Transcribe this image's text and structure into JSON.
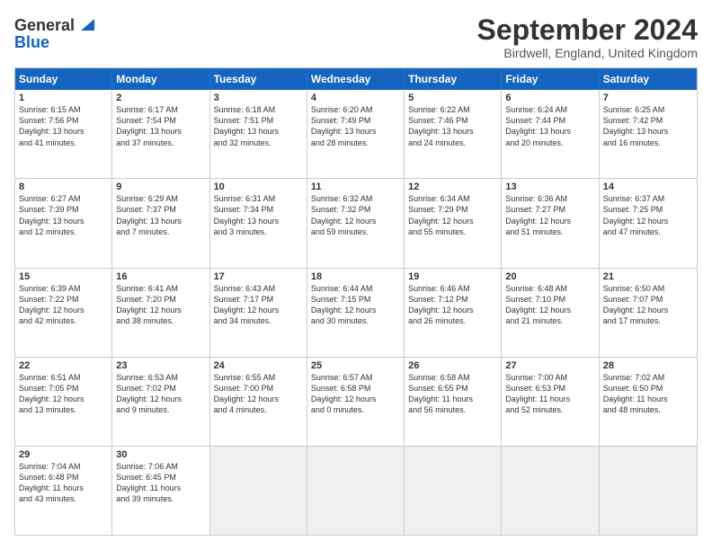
{
  "header": {
    "logo_general": "General",
    "logo_blue": "Blue",
    "month_title": "September 2024",
    "location": "Birdwell, England, United Kingdom"
  },
  "weekdays": [
    "Sunday",
    "Monday",
    "Tuesday",
    "Wednesday",
    "Thursday",
    "Friday",
    "Saturday"
  ],
  "weeks": [
    [
      {
        "day": "1",
        "l1": "Sunrise: 6:15 AM",
        "l2": "Sunset: 7:56 PM",
        "l3": "Daylight: 13 hours",
        "l4": "and 41 minutes."
      },
      {
        "day": "2",
        "l1": "Sunrise: 6:17 AM",
        "l2": "Sunset: 7:54 PM",
        "l3": "Daylight: 13 hours",
        "l4": "and 37 minutes."
      },
      {
        "day": "3",
        "l1": "Sunrise: 6:18 AM",
        "l2": "Sunset: 7:51 PM",
        "l3": "Daylight: 13 hours",
        "l4": "and 32 minutes."
      },
      {
        "day": "4",
        "l1": "Sunrise: 6:20 AM",
        "l2": "Sunset: 7:49 PM",
        "l3": "Daylight: 13 hours",
        "l4": "and 28 minutes."
      },
      {
        "day": "5",
        "l1": "Sunrise: 6:22 AM",
        "l2": "Sunset: 7:46 PM",
        "l3": "Daylight: 13 hours",
        "l4": "and 24 minutes."
      },
      {
        "day": "6",
        "l1": "Sunrise: 6:24 AM",
        "l2": "Sunset: 7:44 PM",
        "l3": "Daylight: 13 hours",
        "l4": "and 20 minutes."
      },
      {
        "day": "7",
        "l1": "Sunrise: 6:25 AM",
        "l2": "Sunset: 7:42 PM",
        "l3": "Daylight: 13 hours",
        "l4": "and 16 minutes."
      }
    ],
    [
      {
        "day": "8",
        "l1": "Sunrise: 6:27 AM",
        "l2": "Sunset: 7:39 PM",
        "l3": "Daylight: 13 hours",
        "l4": "and 12 minutes."
      },
      {
        "day": "9",
        "l1": "Sunrise: 6:29 AM",
        "l2": "Sunset: 7:37 PM",
        "l3": "Daylight: 13 hours",
        "l4": "and 7 minutes."
      },
      {
        "day": "10",
        "l1": "Sunrise: 6:31 AM",
        "l2": "Sunset: 7:34 PM",
        "l3": "Daylight: 13 hours",
        "l4": "and 3 minutes."
      },
      {
        "day": "11",
        "l1": "Sunrise: 6:32 AM",
        "l2": "Sunset: 7:32 PM",
        "l3": "Daylight: 12 hours",
        "l4": "and 59 minutes."
      },
      {
        "day": "12",
        "l1": "Sunrise: 6:34 AM",
        "l2": "Sunset: 7:29 PM",
        "l3": "Daylight: 12 hours",
        "l4": "and 55 minutes."
      },
      {
        "day": "13",
        "l1": "Sunrise: 6:36 AM",
        "l2": "Sunset: 7:27 PM",
        "l3": "Daylight: 12 hours",
        "l4": "and 51 minutes."
      },
      {
        "day": "14",
        "l1": "Sunrise: 6:37 AM",
        "l2": "Sunset: 7:25 PM",
        "l3": "Daylight: 12 hours",
        "l4": "and 47 minutes."
      }
    ],
    [
      {
        "day": "15",
        "l1": "Sunrise: 6:39 AM",
        "l2": "Sunset: 7:22 PM",
        "l3": "Daylight: 12 hours",
        "l4": "and 42 minutes."
      },
      {
        "day": "16",
        "l1": "Sunrise: 6:41 AM",
        "l2": "Sunset: 7:20 PM",
        "l3": "Daylight: 12 hours",
        "l4": "and 38 minutes."
      },
      {
        "day": "17",
        "l1": "Sunrise: 6:43 AM",
        "l2": "Sunset: 7:17 PM",
        "l3": "Daylight: 12 hours",
        "l4": "and 34 minutes."
      },
      {
        "day": "18",
        "l1": "Sunrise: 6:44 AM",
        "l2": "Sunset: 7:15 PM",
        "l3": "Daylight: 12 hours",
        "l4": "and 30 minutes."
      },
      {
        "day": "19",
        "l1": "Sunrise: 6:46 AM",
        "l2": "Sunset: 7:12 PM",
        "l3": "Daylight: 12 hours",
        "l4": "and 26 minutes."
      },
      {
        "day": "20",
        "l1": "Sunrise: 6:48 AM",
        "l2": "Sunset: 7:10 PM",
        "l3": "Daylight: 12 hours",
        "l4": "and 21 minutes."
      },
      {
        "day": "21",
        "l1": "Sunrise: 6:50 AM",
        "l2": "Sunset: 7:07 PM",
        "l3": "Daylight: 12 hours",
        "l4": "and 17 minutes."
      }
    ],
    [
      {
        "day": "22",
        "l1": "Sunrise: 6:51 AM",
        "l2": "Sunset: 7:05 PM",
        "l3": "Daylight: 12 hours",
        "l4": "and 13 minutes."
      },
      {
        "day": "23",
        "l1": "Sunrise: 6:53 AM",
        "l2": "Sunset: 7:02 PM",
        "l3": "Daylight: 12 hours",
        "l4": "and 9 minutes."
      },
      {
        "day": "24",
        "l1": "Sunrise: 6:55 AM",
        "l2": "Sunset: 7:00 PM",
        "l3": "Daylight: 12 hours",
        "l4": "and 4 minutes."
      },
      {
        "day": "25",
        "l1": "Sunrise: 6:57 AM",
        "l2": "Sunset: 6:58 PM",
        "l3": "Daylight: 12 hours",
        "l4": "and 0 minutes."
      },
      {
        "day": "26",
        "l1": "Sunrise: 6:58 AM",
        "l2": "Sunset: 6:55 PM",
        "l3": "Daylight: 11 hours",
        "l4": "and 56 minutes."
      },
      {
        "day": "27",
        "l1": "Sunrise: 7:00 AM",
        "l2": "Sunset: 6:53 PM",
        "l3": "Daylight: 11 hours",
        "l4": "and 52 minutes."
      },
      {
        "day": "28",
        "l1": "Sunrise: 7:02 AM",
        "l2": "Sunset: 6:50 PM",
        "l3": "Daylight: 11 hours",
        "l4": "and 48 minutes."
      }
    ],
    [
      {
        "day": "29",
        "l1": "Sunrise: 7:04 AM",
        "l2": "Sunset: 6:48 PM",
        "l3": "Daylight: 11 hours",
        "l4": "and 43 minutes."
      },
      {
        "day": "30",
        "l1": "Sunrise: 7:06 AM",
        "l2": "Sunset: 6:45 PM",
        "l3": "Daylight: 11 hours",
        "l4": "and 39 minutes."
      },
      {
        "day": "",
        "l1": "",
        "l2": "",
        "l3": "",
        "l4": ""
      },
      {
        "day": "",
        "l1": "",
        "l2": "",
        "l3": "",
        "l4": ""
      },
      {
        "day": "",
        "l1": "",
        "l2": "",
        "l3": "",
        "l4": ""
      },
      {
        "day": "",
        "l1": "",
        "l2": "",
        "l3": "",
        "l4": ""
      },
      {
        "day": "",
        "l1": "",
        "l2": "",
        "l3": "",
        "l4": ""
      }
    ]
  ]
}
